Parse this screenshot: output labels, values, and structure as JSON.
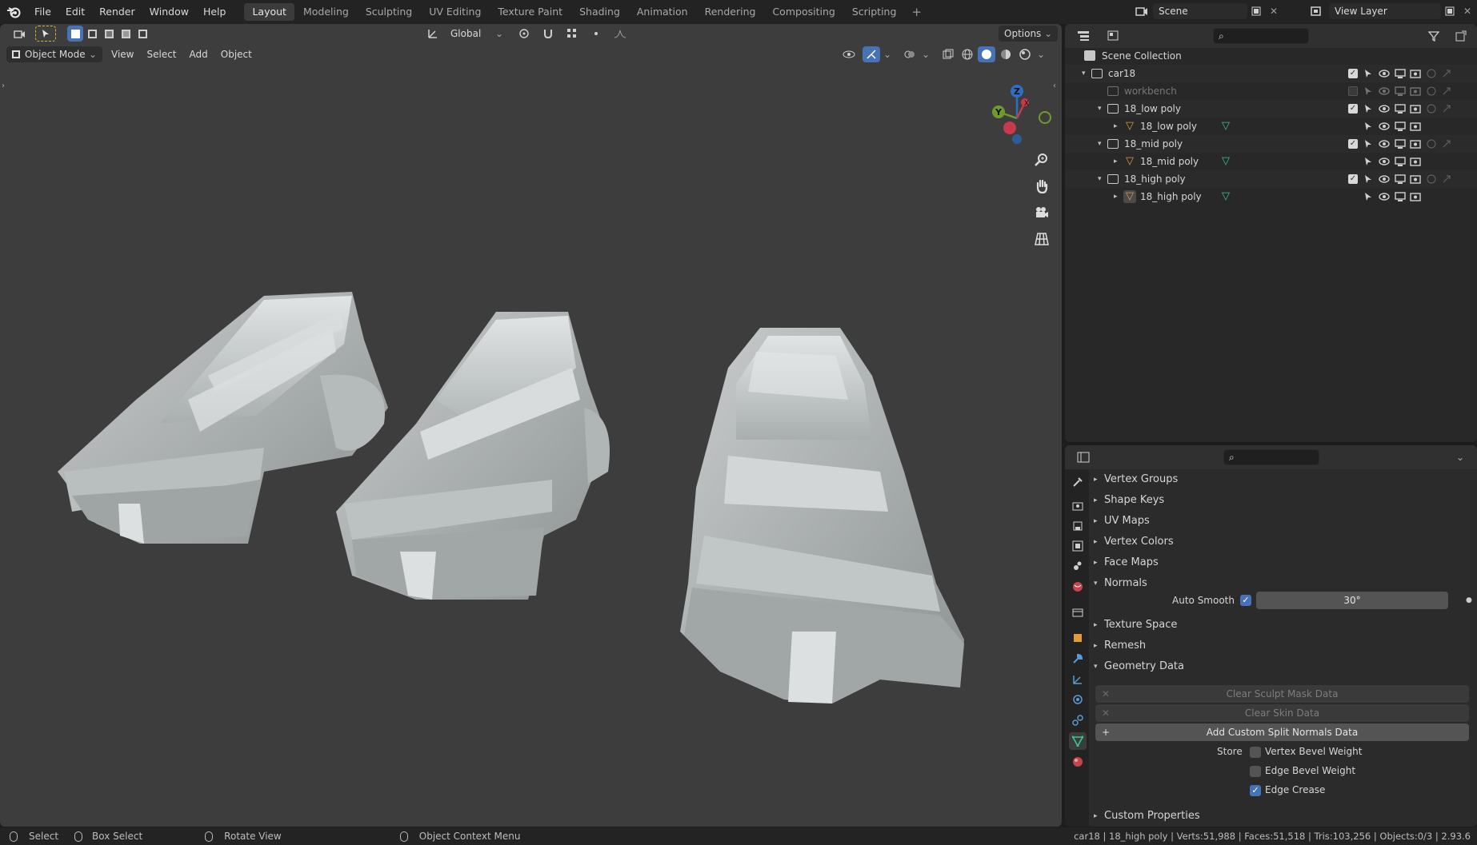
{
  "topbar": {
    "menus": [
      "File",
      "Edit",
      "Render",
      "Window",
      "Help"
    ],
    "workspaces": [
      "Layout",
      "Modeling",
      "Sculpting",
      "UV Editing",
      "Texture Paint",
      "Shading",
      "Animation",
      "Rendering",
      "Compositing",
      "Scripting"
    ],
    "active_workspace": "Layout",
    "add_tab": "+",
    "scene_label": "Scene",
    "view_layer_label": "View Layer"
  },
  "viewport": {
    "transform_orientation": "Global",
    "options_label": "Options",
    "mode": "Object Mode",
    "menus": [
      "View",
      "Select",
      "Add",
      "Object"
    ],
    "gizmo": {
      "x": "X",
      "y": "Y",
      "z": "Z"
    },
    "nav_icons": [
      "zoom-icon",
      "hand-pan-icon",
      "camera-icon",
      "grid-icon"
    ],
    "accent": "#4772b3"
  },
  "outliner": {
    "root": "Scene Collection",
    "items": [
      {
        "label": "car18",
        "type": "collection",
        "depth": 1,
        "checked": true,
        "excluded": false
      },
      {
        "label": "workbench",
        "type": "collection",
        "depth": 2,
        "checked": false,
        "excluded": true
      },
      {
        "label": "18_low poly",
        "type": "collection",
        "depth": 2,
        "checked": true,
        "excluded": false
      },
      {
        "label": "18_low poly",
        "type": "object",
        "depth": 3
      },
      {
        "label": "18_mid poly",
        "type": "collection",
        "depth": 2,
        "checked": true,
        "excluded": false
      },
      {
        "label": "18_mid poly",
        "type": "object",
        "depth": 3
      },
      {
        "label": "18_high poly",
        "type": "collection",
        "depth": 2,
        "checked": true,
        "excluded": false
      },
      {
        "label": "18_high poly",
        "type": "object",
        "depth": 3
      }
    ]
  },
  "properties": {
    "panels": [
      {
        "label": "Vertex Groups",
        "open": false
      },
      {
        "label": "Shape Keys",
        "open": false
      },
      {
        "label": "UV Maps",
        "open": false
      },
      {
        "label": "Vertex Colors",
        "open": false
      },
      {
        "label": "Face Maps",
        "open": false
      },
      {
        "label": "Normals",
        "open": true
      }
    ],
    "auto_smooth_label": "Auto Smooth",
    "auto_smooth_checked": true,
    "auto_smooth_angle": "30°",
    "panels2": [
      {
        "label": "Texture Space",
        "open": false
      },
      {
        "label": "Remesh",
        "open": false
      },
      {
        "label": "Geometry Data",
        "open": true
      }
    ],
    "buttons": [
      {
        "label": "Clear Sculpt Mask Data",
        "disabled": true,
        "icon": "✕"
      },
      {
        "label": "Clear Skin Data",
        "disabled": true,
        "icon": "✕"
      },
      {
        "label": "Add Custom Split Normals Data",
        "disabled": false,
        "icon": "+"
      }
    ],
    "store_label": "Store",
    "store_options": [
      {
        "label": "Vertex Bevel Weight",
        "checked": false
      },
      {
        "label": "Edge Bevel Weight",
        "checked": false
      },
      {
        "label": "Edge Crease",
        "checked": true
      }
    ],
    "custom_properties": "Custom Properties"
  },
  "statusbar": {
    "select": "Select",
    "box_select": "Box Select",
    "rotate_view": "Rotate View",
    "context_menu": "Object Context Menu",
    "stats": "car18 | 18_high poly | Verts:51,988 | Faces:51,518 | Tris:103,256 | Objects:0/3 | 2.93.6"
  }
}
